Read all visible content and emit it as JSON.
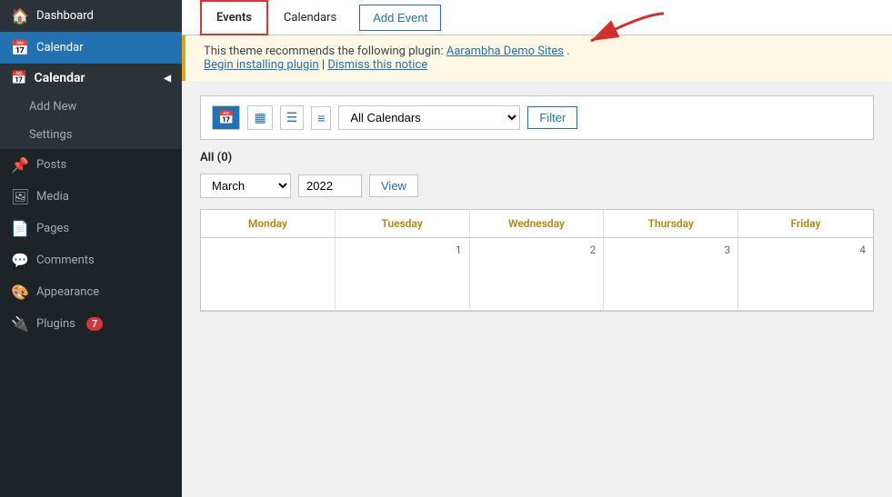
{
  "sidebar": {
    "items": [
      {
        "id": "dashboard",
        "label": "Dashboard",
        "icon": "🏠",
        "active": false
      },
      {
        "id": "calendar",
        "label": "Calendar",
        "icon": "📅",
        "active": true
      },
      {
        "id": "calendar-parent",
        "label": "Calendar",
        "icon": "📅",
        "isParent": true
      },
      {
        "id": "add-new",
        "label": "Add New",
        "icon": "",
        "isSubItem": true
      },
      {
        "id": "settings",
        "label": "Settings",
        "icon": "",
        "isSubItem": true
      },
      {
        "id": "posts",
        "label": "Posts",
        "icon": "📌",
        "active": false
      },
      {
        "id": "media",
        "label": "Media",
        "icon": "🖼",
        "active": false
      },
      {
        "id": "pages",
        "label": "Pages",
        "icon": "📄",
        "active": false
      },
      {
        "id": "comments",
        "label": "Comments",
        "icon": "💬",
        "active": false
      },
      {
        "id": "appearance",
        "label": "Appearance",
        "icon": "🎨",
        "active": false
      },
      {
        "id": "plugins",
        "label": "Plugins",
        "icon": "🔌",
        "active": false,
        "badge": "7"
      }
    ]
  },
  "tabs": {
    "items": [
      {
        "id": "events",
        "label": "Events",
        "active": true
      },
      {
        "id": "calendars",
        "label": "Calendars",
        "active": false
      },
      {
        "id": "add-event",
        "label": "Add Event",
        "active": false
      }
    ]
  },
  "notice": {
    "text": "This theme recommends the following plugin: ",
    "plugin_link": "Aarambha Demo Sites",
    "plugin_link_suffix": ".",
    "install_label": "Begin installing plugin",
    "dismiss_label": "Dismiss this notice"
  },
  "toolbar": {
    "calendars_placeholder": "All Calendars",
    "filter_label": "Filter"
  },
  "calendar_view": {
    "all_label": "All",
    "all_count": "(0)",
    "month_value": "March",
    "year_value": "2022",
    "view_button_label": "View",
    "days": [
      "Monday",
      "Tuesday",
      "Wednesday",
      "Thursday",
      "Friday"
    ],
    "rows": [
      [
        {
          "day": "",
          "num": ""
        },
        {
          "day": "",
          "num": "1"
        },
        {
          "day": "",
          "num": "2"
        },
        {
          "day": "",
          "num": "3"
        },
        {
          "day": "",
          "num": "4"
        }
      ]
    ]
  }
}
